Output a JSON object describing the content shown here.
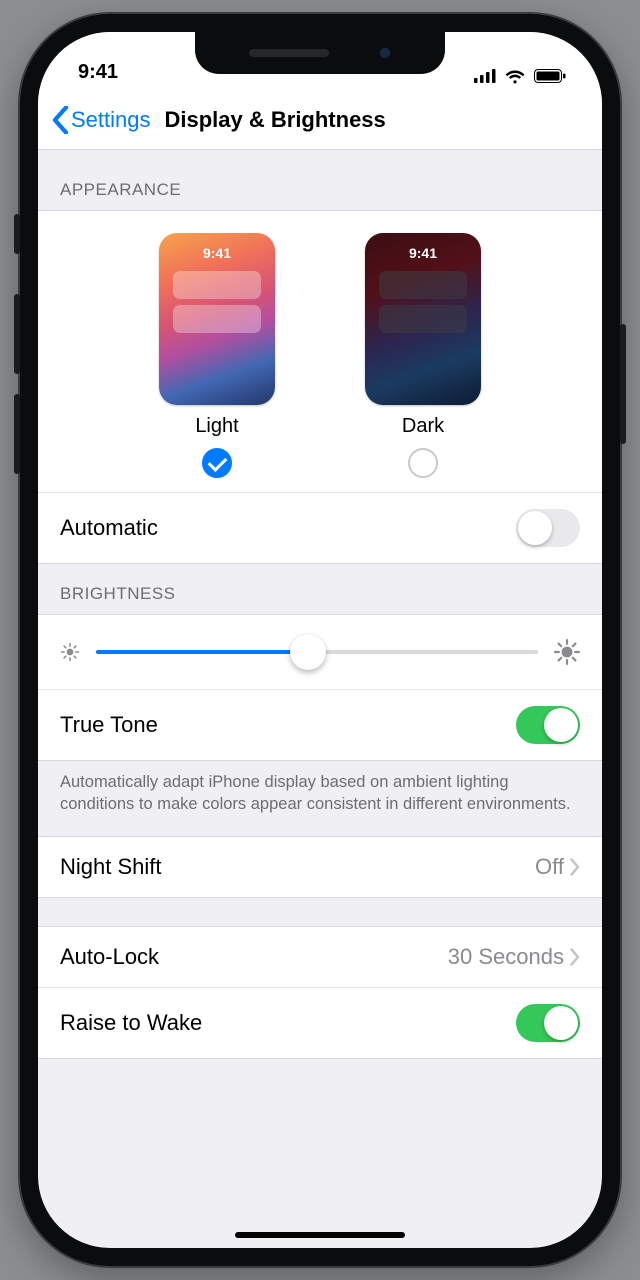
{
  "status": {
    "time": "9:41"
  },
  "nav": {
    "back_label": "Settings",
    "title": "Display & Brightness"
  },
  "sections": {
    "appearance": {
      "header": "APPEARANCE",
      "options": {
        "light": {
          "label": "Light",
          "preview_time": "9:41",
          "selected": true
        },
        "dark": {
          "label": "Dark",
          "preview_time": "9:41",
          "selected": false
        }
      },
      "automatic": {
        "label": "Automatic",
        "enabled": false
      }
    },
    "brightness": {
      "header": "BRIGHTNESS",
      "slider_percent": 48,
      "true_tone": {
        "label": "True Tone",
        "enabled": true
      },
      "footer": "Automatically adapt iPhone display based on ambient lighting conditions to make colors appear consistent in different environments."
    },
    "night_shift": {
      "label": "Night Shift",
      "value": "Off"
    },
    "more": {
      "auto_lock": {
        "label": "Auto-Lock",
        "value": "30 Seconds"
      },
      "raise_to_wake": {
        "label": "Raise to Wake",
        "enabled": true
      }
    }
  }
}
